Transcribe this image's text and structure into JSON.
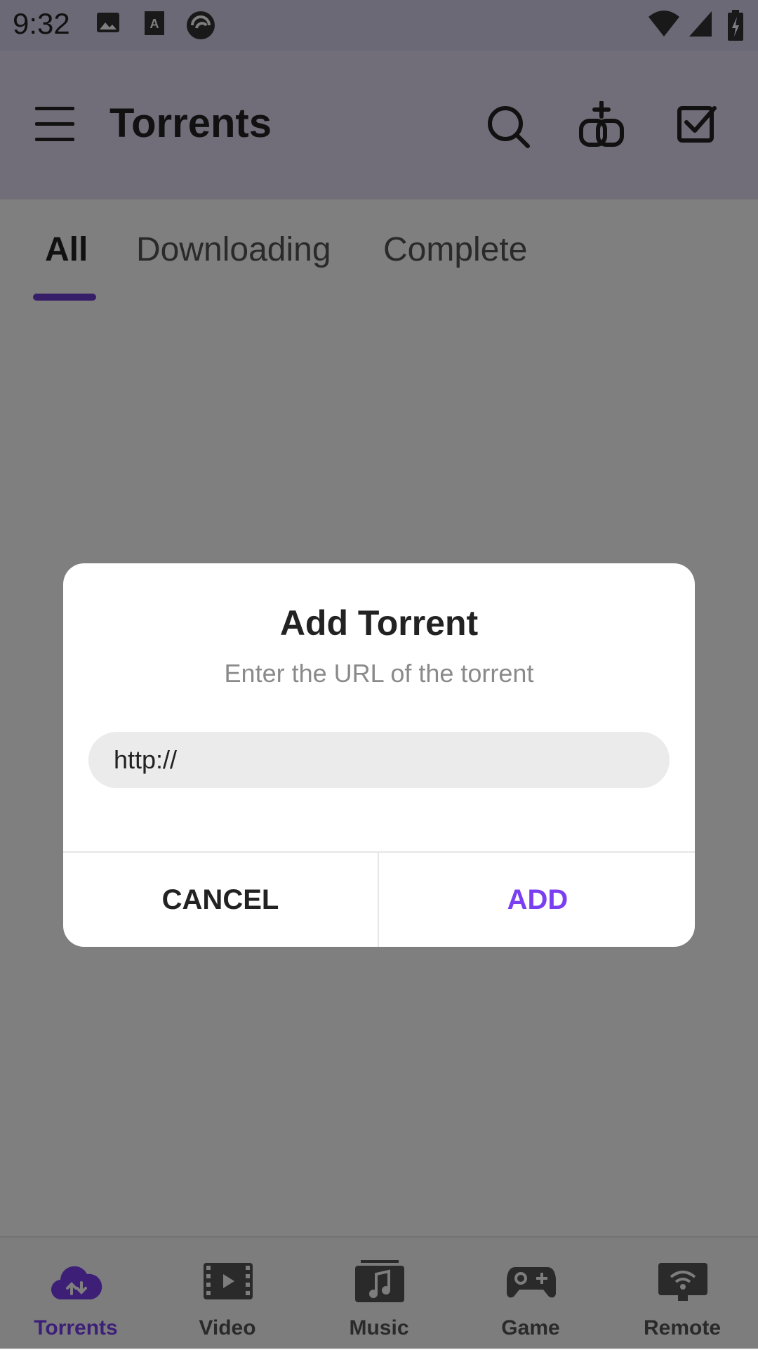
{
  "status_bar": {
    "time": "9:32",
    "notification_icons": [
      "image-icon",
      "text-box-icon",
      "bittorrent-icon"
    ],
    "system_icons": [
      "wifi-icon",
      "signal-icon",
      "battery-charging-icon"
    ]
  },
  "app_bar": {
    "title": "Torrents",
    "actions": [
      "menu-icon",
      "search-icon",
      "add-link-icon",
      "select-all-checkbox-icon"
    ]
  },
  "tabs": {
    "items": [
      "All",
      "Downloading",
      "Complete"
    ],
    "selected": "All"
  },
  "bottom_nav": {
    "items": [
      {
        "label": "Torrents",
        "icon": "cloud-upload-download-icon",
        "active": true
      },
      {
        "label": "Video",
        "icon": "film-icon",
        "active": false
      },
      {
        "label": "Music",
        "icon": "music-note-icon",
        "active": false
      },
      {
        "label": "Game",
        "icon": "gamepad-icon",
        "active": false
      },
      {
        "label": "Remote",
        "icon": "remote-wifi-icon",
        "active": false
      }
    ]
  },
  "dialog": {
    "title": "Add Torrent",
    "subtitle": "Enter the URL of the torrent",
    "input_value": "http://",
    "cancel_label": "CANCEL",
    "add_label": "ADD"
  },
  "colors": {
    "accent": "#7a3ff0",
    "indicator": "#6d3fd1",
    "text_dark": "#222222",
    "text_muted": "#8a8a8a"
  }
}
